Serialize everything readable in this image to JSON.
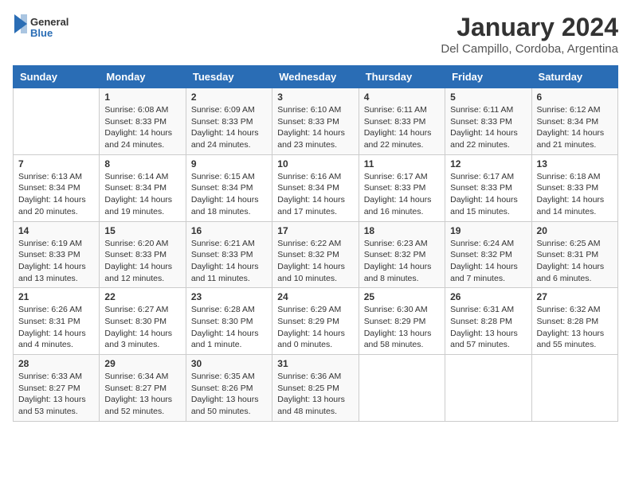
{
  "logo": {
    "general": "General",
    "blue": "Blue"
  },
  "title": "January 2024",
  "subtitle": "Del Campillo, Cordoba, Argentina",
  "days_of_week": [
    "Sunday",
    "Monday",
    "Tuesday",
    "Wednesday",
    "Thursday",
    "Friday",
    "Saturday"
  ],
  "weeks": [
    [
      {
        "day": "",
        "info": ""
      },
      {
        "day": "1",
        "info": "Sunrise: 6:08 AM\nSunset: 8:33 PM\nDaylight: 14 hours and 24 minutes."
      },
      {
        "day": "2",
        "info": "Sunrise: 6:09 AM\nSunset: 8:33 PM\nDaylight: 14 hours and 24 minutes."
      },
      {
        "day": "3",
        "info": "Sunrise: 6:10 AM\nSunset: 8:33 PM\nDaylight: 14 hours and 23 minutes."
      },
      {
        "day": "4",
        "info": "Sunrise: 6:11 AM\nSunset: 8:33 PM\nDaylight: 14 hours and 22 minutes."
      },
      {
        "day": "5",
        "info": "Sunrise: 6:11 AM\nSunset: 8:33 PM\nDaylight: 14 hours and 22 minutes."
      },
      {
        "day": "6",
        "info": "Sunrise: 6:12 AM\nSunset: 8:34 PM\nDaylight: 14 hours and 21 minutes."
      }
    ],
    [
      {
        "day": "7",
        "info": "Sunrise: 6:13 AM\nSunset: 8:34 PM\nDaylight: 14 hours and 20 minutes."
      },
      {
        "day": "8",
        "info": "Sunrise: 6:14 AM\nSunset: 8:34 PM\nDaylight: 14 hours and 19 minutes."
      },
      {
        "day": "9",
        "info": "Sunrise: 6:15 AM\nSunset: 8:34 PM\nDaylight: 14 hours and 18 minutes."
      },
      {
        "day": "10",
        "info": "Sunrise: 6:16 AM\nSunset: 8:34 PM\nDaylight: 14 hours and 17 minutes."
      },
      {
        "day": "11",
        "info": "Sunrise: 6:17 AM\nSunset: 8:33 PM\nDaylight: 14 hours and 16 minutes."
      },
      {
        "day": "12",
        "info": "Sunrise: 6:17 AM\nSunset: 8:33 PM\nDaylight: 14 hours and 15 minutes."
      },
      {
        "day": "13",
        "info": "Sunrise: 6:18 AM\nSunset: 8:33 PM\nDaylight: 14 hours and 14 minutes."
      }
    ],
    [
      {
        "day": "14",
        "info": "Sunrise: 6:19 AM\nSunset: 8:33 PM\nDaylight: 14 hours and 13 minutes."
      },
      {
        "day": "15",
        "info": "Sunrise: 6:20 AM\nSunset: 8:33 PM\nDaylight: 14 hours and 12 minutes."
      },
      {
        "day": "16",
        "info": "Sunrise: 6:21 AM\nSunset: 8:33 PM\nDaylight: 14 hours and 11 minutes."
      },
      {
        "day": "17",
        "info": "Sunrise: 6:22 AM\nSunset: 8:32 PM\nDaylight: 14 hours and 10 minutes."
      },
      {
        "day": "18",
        "info": "Sunrise: 6:23 AM\nSunset: 8:32 PM\nDaylight: 14 hours and 8 minutes."
      },
      {
        "day": "19",
        "info": "Sunrise: 6:24 AM\nSunset: 8:32 PM\nDaylight: 14 hours and 7 minutes."
      },
      {
        "day": "20",
        "info": "Sunrise: 6:25 AM\nSunset: 8:31 PM\nDaylight: 14 hours and 6 minutes."
      }
    ],
    [
      {
        "day": "21",
        "info": "Sunrise: 6:26 AM\nSunset: 8:31 PM\nDaylight: 14 hours and 4 minutes."
      },
      {
        "day": "22",
        "info": "Sunrise: 6:27 AM\nSunset: 8:30 PM\nDaylight: 14 hours and 3 minutes."
      },
      {
        "day": "23",
        "info": "Sunrise: 6:28 AM\nSunset: 8:30 PM\nDaylight: 14 hours and 1 minute."
      },
      {
        "day": "24",
        "info": "Sunrise: 6:29 AM\nSunset: 8:29 PM\nDaylight: 14 hours and 0 minutes."
      },
      {
        "day": "25",
        "info": "Sunrise: 6:30 AM\nSunset: 8:29 PM\nDaylight: 13 hours and 58 minutes."
      },
      {
        "day": "26",
        "info": "Sunrise: 6:31 AM\nSunset: 8:28 PM\nDaylight: 13 hours and 57 minutes."
      },
      {
        "day": "27",
        "info": "Sunrise: 6:32 AM\nSunset: 8:28 PM\nDaylight: 13 hours and 55 minutes."
      }
    ],
    [
      {
        "day": "28",
        "info": "Sunrise: 6:33 AM\nSunset: 8:27 PM\nDaylight: 13 hours and 53 minutes."
      },
      {
        "day": "29",
        "info": "Sunrise: 6:34 AM\nSunset: 8:27 PM\nDaylight: 13 hours and 52 minutes."
      },
      {
        "day": "30",
        "info": "Sunrise: 6:35 AM\nSunset: 8:26 PM\nDaylight: 13 hours and 50 minutes."
      },
      {
        "day": "31",
        "info": "Sunrise: 6:36 AM\nSunset: 8:25 PM\nDaylight: 13 hours and 48 minutes."
      },
      {
        "day": "",
        "info": ""
      },
      {
        "day": "",
        "info": ""
      },
      {
        "day": "",
        "info": ""
      }
    ]
  ]
}
